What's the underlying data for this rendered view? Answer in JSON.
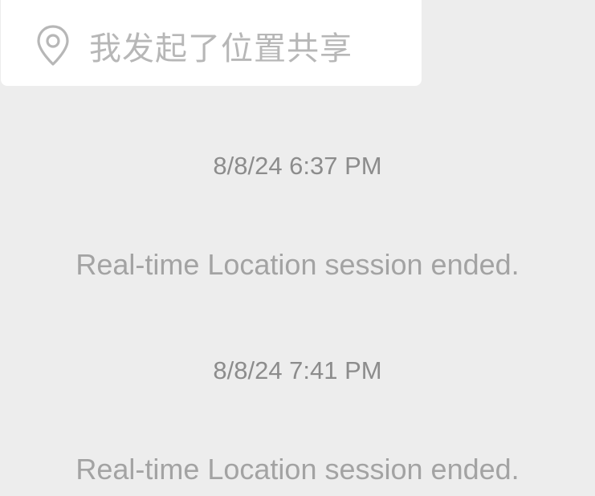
{
  "location_bubble": {
    "icon": "location-pin-icon",
    "text": "我发起了位置共享",
    "background": "#ffffff",
    "text_color": "#b7b7b7"
  },
  "events": [
    {
      "timestamp": "8/8/24 6:37 PM",
      "message": "Real-time Location session ended."
    },
    {
      "timestamp": "8/8/24 7:41 PM",
      "message": "Real-time Location session ended."
    }
  ],
  "colors": {
    "background": "#ededed",
    "timestamp": "#8c8c8c",
    "system_message": "#a3a3a3"
  }
}
